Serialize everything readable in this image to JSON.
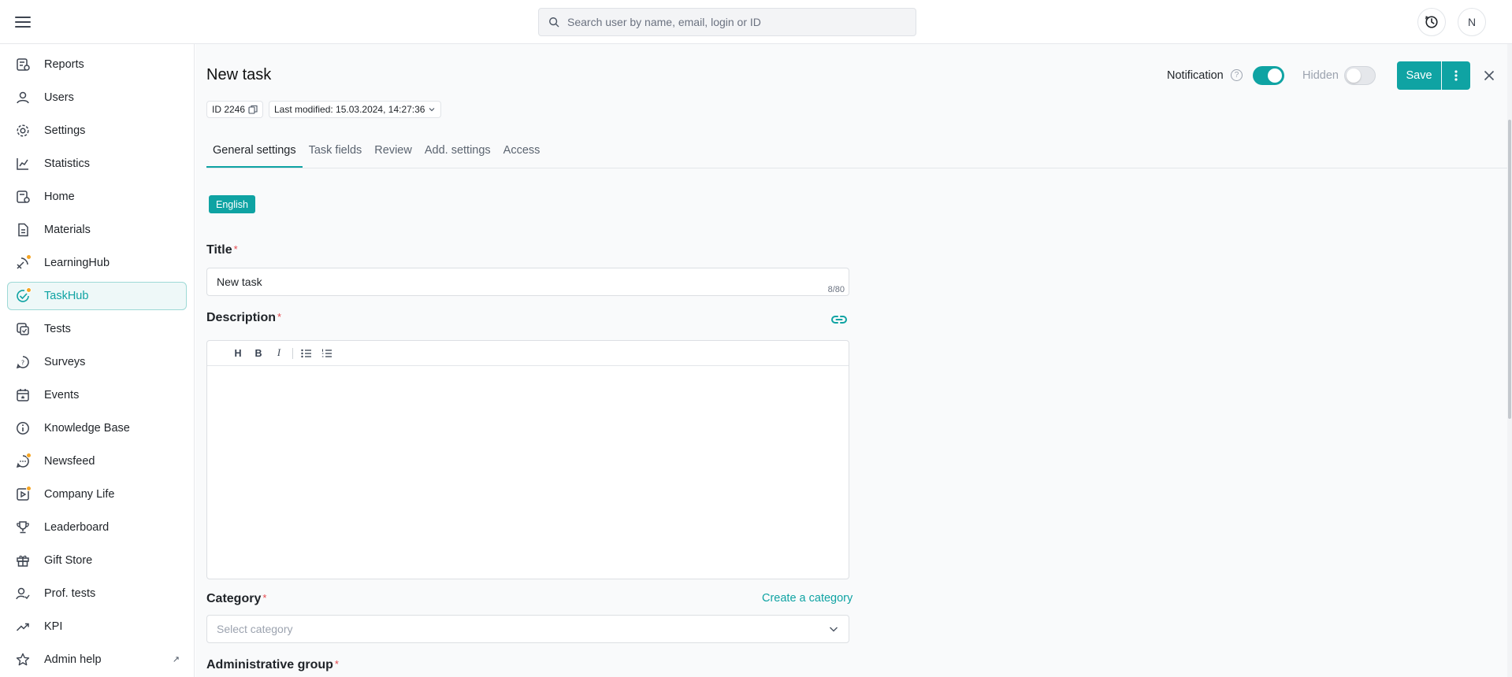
{
  "header": {
    "search_placeholder": "Search user by name, email, login or ID",
    "avatar_initial": "N"
  },
  "sidebar": {
    "items": [
      {
        "label": "Reports",
        "icon": "reports-icon",
        "badge": false
      },
      {
        "label": "Users",
        "icon": "user-icon",
        "badge": false
      },
      {
        "label": "Settings",
        "icon": "gear-icon",
        "badge": false
      },
      {
        "label": "Statistics",
        "icon": "chart-line-icon",
        "badge": false
      },
      {
        "label": "Home",
        "icon": "home-icon",
        "badge": false
      },
      {
        "label": "Materials",
        "icon": "document-icon",
        "badge": false
      },
      {
        "label": "LearningHub",
        "icon": "learning-icon",
        "badge": true
      },
      {
        "label": "TaskHub",
        "icon": "check-circle-icon",
        "badge": true,
        "active": true
      },
      {
        "label": "Tests",
        "icon": "tests-icon",
        "badge": false
      },
      {
        "label": "Surveys",
        "icon": "survey-icon",
        "badge": false
      },
      {
        "label": "Events",
        "icon": "calendar-icon",
        "badge": false
      },
      {
        "label": "Knowledge Base",
        "icon": "info-icon",
        "badge": false
      },
      {
        "label": "Newsfeed",
        "icon": "chat-icon",
        "badge": true
      },
      {
        "label": "Company Life",
        "icon": "video-icon",
        "badge": true
      },
      {
        "label": "Leaderboard",
        "icon": "trophy-icon",
        "badge": false
      },
      {
        "label": "Gift Store",
        "icon": "gift-icon",
        "badge": false
      },
      {
        "label": "Prof. tests",
        "icon": "profile-test-icon",
        "badge": false
      },
      {
        "label": "KPI",
        "icon": "trend-up-icon",
        "badge": false
      },
      {
        "label": "Admin help",
        "icon": "star-icon",
        "badge": false,
        "external": true
      }
    ]
  },
  "page": {
    "title": "New task",
    "notification_label": "Notification",
    "notification_on": true,
    "hidden_label": "Hidden",
    "hidden_on": false,
    "save_label": "Save",
    "id_label": "ID 2246",
    "last_modified": "Last modified: 15.03.2024, 14:27:36"
  },
  "tabs": [
    "General settings",
    "Task fields",
    "Review",
    "Add. settings",
    "Access"
  ],
  "form": {
    "language": "English",
    "title_label": "Title",
    "title_value": "New task",
    "title_count": "8/80",
    "description_label": "Description",
    "toolbar": {
      "heading": "H",
      "bold": "B",
      "italic": "I"
    },
    "category_label": "Category",
    "create_category": "Create a category",
    "category_placeholder": "Select category",
    "admin_group_label": "Administrative group",
    "required_mark": "*"
  },
  "colors": {
    "accent": "#0fa3a3",
    "required": "#e5484d",
    "badge": "#f5a524"
  }
}
